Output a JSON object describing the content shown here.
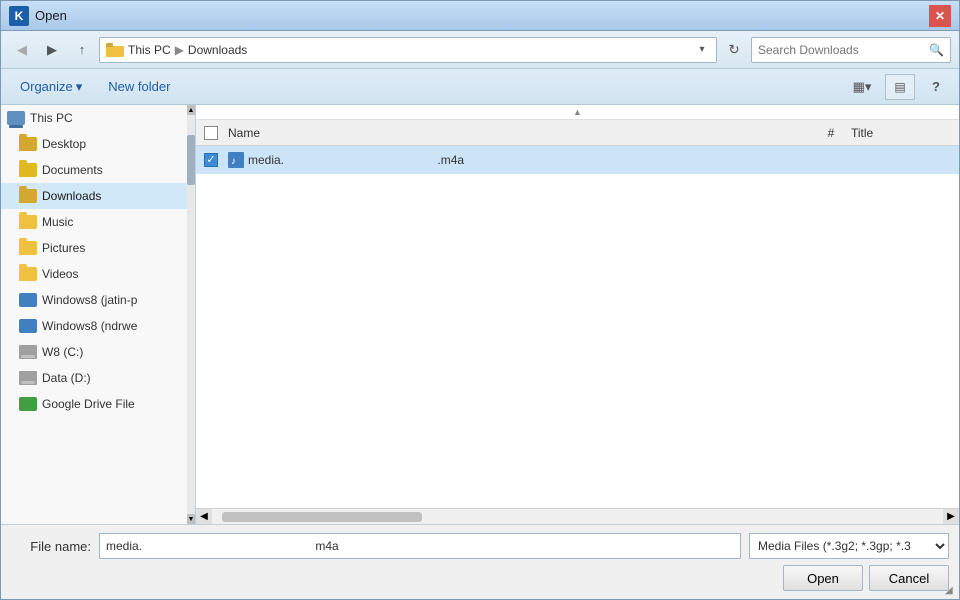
{
  "dialog": {
    "title": "Open"
  },
  "titlebar": {
    "app_label": "K",
    "title": "Open",
    "close_label": "✕"
  },
  "toolbar": {
    "back_label": "◀",
    "forward_label": "▶",
    "up_label": "↑",
    "path_icon": "📁",
    "path_this_pc": "This PC",
    "path_sep": "▶",
    "path_current": "Downloads",
    "path_dropdown_label": "▾",
    "refresh_label": "↻",
    "search_placeholder": "Search Downloads",
    "search_icon": "🔍"
  },
  "actionbar": {
    "organize_label": "Organize",
    "organize_arrow": "▾",
    "new_folder_label": "New folder",
    "view_icon": "▦",
    "view_dropdown": "▾",
    "pane_label": "▤",
    "help_label": "?"
  },
  "sidebar": {
    "items": [
      {
        "id": "this-pc",
        "label": "This PC",
        "icon_type": "this-pc",
        "indent": 0
      },
      {
        "id": "desktop",
        "label": "Desktop",
        "icon_type": "folder-desktop",
        "indent": 1
      },
      {
        "id": "documents",
        "label": "Documents",
        "icon_type": "folder-documents",
        "indent": 1
      },
      {
        "id": "downloads",
        "label": "Downloads",
        "icon_type": "folder-downloads",
        "indent": 1,
        "selected": true
      },
      {
        "id": "music",
        "label": "Music",
        "icon_type": "folder-music",
        "indent": 1
      },
      {
        "id": "pictures",
        "label": "Pictures",
        "icon_type": "folder-pictures",
        "indent": 1
      },
      {
        "id": "videos",
        "label": "Videos",
        "icon_type": "folder-videos",
        "indent": 1
      },
      {
        "id": "windows8-jatin",
        "label": "Windows8 (jatin-p",
        "icon_type": "windows8",
        "indent": 1
      },
      {
        "id": "windows8-ndrwe",
        "label": "Windows8 (ndrwe",
        "icon_type": "windows8",
        "indent": 1
      },
      {
        "id": "w8-c",
        "label": "W8 (C:)",
        "icon_type": "drive",
        "indent": 1
      },
      {
        "id": "data-d",
        "label": "Data (D:)",
        "icon_type": "drive",
        "indent": 1
      },
      {
        "id": "google-drive",
        "label": "Google Drive File",
        "icon_type": "gdrive",
        "indent": 1
      }
    ]
  },
  "filelist": {
    "columns": {
      "name": "Name",
      "hash": "#",
      "title": "Title"
    },
    "files": [
      {
        "id": "media-file",
        "name": "media.",
        "name_full": "media.                                       .m4a",
        "extension": ".m4a",
        "checked": true
      }
    ]
  },
  "bottom": {
    "filename_label": "File name:",
    "filename_value": "media.                                                    m4a",
    "filetype_label": "Media Files (*.3g2; *.3gp; *.3",
    "open_label": "Open",
    "cancel_label": "Cancel"
  },
  "scrollbar": {
    "left_arrow": "◀",
    "right_arrow": "▶"
  }
}
